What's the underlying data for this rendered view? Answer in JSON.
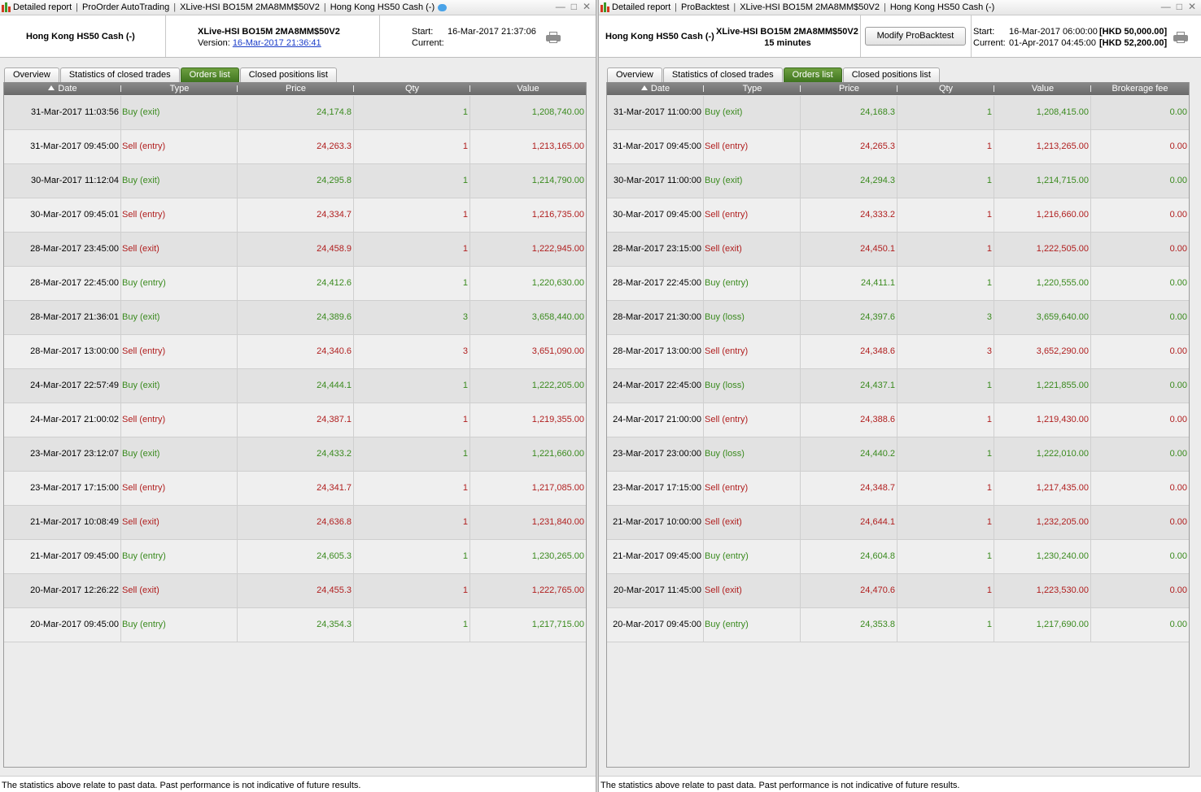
{
  "left": {
    "titlebar": {
      "segments": [
        "Detailed report",
        "ProOrder AutoTrading",
        "XLive-HSI BO15M 2MA8MM$50V2",
        "Hong Kong HS50 Cash (-)"
      ]
    },
    "header": {
      "instrument": "Hong Kong HS50 Cash (-)",
      "system_name": "XLive-HSI BO15M 2MA8MM$50V2",
      "version_label": "Version:",
      "version_value": "16-Mar-2017 21:36:41",
      "start_label": "Start:",
      "start_value": "16-Mar-2017 21:37:06",
      "current_label": "Current:"
    },
    "tabs": [
      "Overview",
      "Statistics of closed trades",
      "Orders list",
      "Closed positions list"
    ],
    "active_tab": 2,
    "columns": [
      "Date",
      "Type",
      "Price",
      "Qty",
      "Value"
    ],
    "rows": [
      {
        "date": "31-Mar-2017 11:03:56",
        "type": "Buy (exit)",
        "side": "buy",
        "price": "24,174.8",
        "qty": "1",
        "value": "1,208,740.00"
      },
      {
        "date": "31-Mar-2017 09:45:00",
        "type": "Sell (entry)",
        "side": "sell",
        "price": "24,263.3",
        "qty": "1",
        "value": "1,213,165.00"
      },
      {
        "date": "30-Mar-2017 11:12:04",
        "type": "Buy (exit)",
        "side": "buy",
        "price": "24,295.8",
        "qty": "1",
        "value": "1,214,790.00"
      },
      {
        "date": "30-Mar-2017 09:45:01",
        "type": "Sell (entry)",
        "side": "sell",
        "price": "24,334.7",
        "qty": "1",
        "value": "1,216,735.00"
      },
      {
        "date": "28-Mar-2017 23:45:00",
        "type": "Sell (exit)",
        "side": "sell",
        "price": "24,458.9",
        "qty": "1",
        "value": "1,222,945.00"
      },
      {
        "date": "28-Mar-2017 22:45:00",
        "type": "Buy (entry)",
        "side": "buy",
        "price": "24,412.6",
        "qty": "1",
        "value": "1,220,630.00"
      },
      {
        "date": "28-Mar-2017 21:36:01",
        "type": "Buy (exit)",
        "side": "buy",
        "price": "24,389.6",
        "qty": "3",
        "value": "3,658,440.00"
      },
      {
        "date": "28-Mar-2017 13:00:00",
        "type": "Sell (entry)",
        "side": "sell",
        "price": "24,340.6",
        "qty": "3",
        "value": "3,651,090.00"
      },
      {
        "date": "24-Mar-2017 22:57:49",
        "type": "Buy (exit)",
        "side": "buy",
        "price": "24,444.1",
        "qty": "1",
        "value": "1,222,205.00"
      },
      {
        "date": "24-Mar-2017 21:00:02",
        "type": "Sell (entry)",
        "side": "sell",
        "price": "24,387.1",
        "qty": "1",
        "value": "1,219,355.00"
      },
      {
        "date": "23-Mar-2017 23:12:07",
        "type": "Buy (exit)",
        "side": "buy",
        "price": "24,433.2",
        "qty": "1",
        "value": "1,221,660.00"
      },
      {
        "date": "23-Mar-2017 17:15:00",
        "type": "Sell (entry)",
        "side": "sell",
        "price": "24,341.7",
        "qty": "1",
        "value": "1,217,085.00"
      },
      {
        "date": "21-Mar-2017 10:08:49",
        "type": "Sell (exit)",
        "side": "sell",
        "price": "24,636.8",
        "qty": "1",
        "value": "1,231,840.00"
      },
      {
        "date": "21-Mar-2017 09:45:00",
        "type": "Buy (entry)",
        "side": "buy",
        "price": "24,605.3",
        "qty": "1",
        "value": "1,230,265.00"
      },
      {
        "date": "20-Mar-2017 12:26:22",
        "type": "Sell (exit)",
        "side": "sell",
        "price": "24,455.3",
        "qty": "1",
        "value": "1,222,765.00"
      },
      {
        "date": "20-Mar-2017 09:45:00",
        "type": "Buy (entry)",
        "side": "buy",
        "price": "24,354.3",
        "qty": "1",
        "value": "1,217,715.00"
      }
    ],
    "footer": "The statistics above relate to past data. Past performance is not indicative of future results."
  },
  "right": {
    "titlebar": {
      "segments": [
        "Detailed report",
        "ProBacktest",
        "XLive-HSI BO15M 2MA8MM$50V2",
        "Hong Kong HS50 Cash (-)"
      ]
    },
    "header": {
      "instrument": "Hong Kong HS50 Cash (-)",
      "system_name": "XLive-HSI BO15M 2MA8MM$50V2",
      "timeframe": "15 minutes",
      "modify_button": "Modify ProBacktest",
      "start_label": "Start:",
      "start_value": "16-Mar-2017 06:00:00",
      "start_capital": "[HKD 50,000.00]",
      "current_label": "Current:",
      "current_value": "01-Apr-2017 04:45:00",
      "current_capital": "[HKD 52,200.00]"
    },
    "tabs": [
      "Overview",
      "Statistics of closed trades",
      "Orders list",
      "Closed positions list"
    ],
    "active_tab": 2,
    "columns": [
      "Date",
      "Type",
      "Price",
      "Qty",
      "Value",
      "Brokerage fee"
    ],
    "rows": [
      {
        "date": "31-Mar-2017 11:00:00",
        "type": "Buy (exit)",
        "side": "buy",
        "price": "24,168.3",
        "qty": "1",
        "value": "1,208,415.00",
        "fee": "0.00"
      },
      {
        "date": "31-Mar-2017 09:45:00",
        "type": "Sell (entry)",
        "side": "sell",
        "price": "24,265.3",
        "qty": "1",
        "value": "1,213,265.00",
        "fee": "0.00"
      },
      {
        "date": "30-Mar-2017 11:00:00",
        "type": "Buy (exit)",
        "side": "buy",
        "price": "24,294.3",
        "qty": "1",
        "value": "1,214,715.00",
        "fee": "0.00"
      },
      {
        "date": "30-Mar-2017 09:45:00",
        "type": "Sell (entry)",
        "side": "sell",
        "price": "24,333.2",
        "qty": "1",
        "value": "1,216,660.00",
        "fee": "0.00"
      },
      {
        "date": "28-Mar-2017 23:15:00",
        "type": "Sell (exit)",
        "side": "sell",
        "price": "24,450.1",
        "qty": "1",
        "value": "1,222,505.00",
        "fee": "0.00"
      },
      {
        "date": "28-Mar-2017 22:45:00",
        "type": "Buy (entry)",
        "side": "buy",
        "price": "24,411.1",
        "qty": "1",
        "value": "1,220,555.00",
        "fee": "0.00"
      },
      {
        "date": "28-Mar-2017 21:30:00",
        "type": "Buy (loss)",
        "side": "buy",
        "price": "24,397.6",
        "qty": "3",
        "value": "3,659,640.00",
        "fee": "0.00"
      },
      {
        "date": "28-Mar-2017 13:00:00",
        "type": "Sell (entry)",
        "side": "sell",
        "price": "24,348.6",
        "qty": "3",
        "value": "3,652,290.00",
        "fee": "0.00"
      },
      {
        "date": "24-Mar-2017 22:45:00",
        "type": "Buy (loss)",
        "side": "buy",
        "price": "24,437.1",
        "qty": "1",
        "value": "1,221,855.00",
        "fee": "0.00"
      },
      {
        "date": "24-Mar-2017 21:00:00",
        "type": "Sell (entry)",
        "side": "sell",
        "price": "24,388.6",
        "qty": "1",
        "value": "1,219,430.00",
        "fee": "0.00"
      },
      {
        "date": "23-Mar-2017 23:00:00",
        "type": "Buy (loss)",
        "side": "buy",
        "price": "24,440.2",
        "qty": "1",
        "value": "1,222,010.00",
        "fee": "0.00"
      },
      {
        "date": "23-Mar-2017 17:15:00",
        "type": "Sell (entry)",
        "side": "sell",
        "price": "24,348.7",
        "qty": "1",
        "value": "1,217,435.00",
        "fee": "0.00"
      },
      {
        "date": "21-Mar-2017 10:00:00",
        "type": "Sell (exit)",
        "side": "sell",
        "price": "24,644.1",
        "qty": "1",
        "value": "1,232,205.00",
        "fee": "0.00"
      },
      {
        "date": "21-Mar-2017 09:45:00",
        "type": "Buy (entry)",
        "side": "buy",
        "price": "24,604.8",
        "qty": "1",
        "value": "1,230,240.00",
        "fee": "0.00"
      },
      {
        "date": "20-Mar-2017 11:45:00",
        "type": "Sell (exit)",
        "side": "sell",
        "price": "24,470.6",
        "qty": "1",
        "value": "1,223,530.00",
        "fee": "0.00"
      },
      {
        "date": "20-Mar-2017 09:45:00",
        "type": "Buy (entry)",
        "side": "buy",
        "price": "24,353.8",
        "qty": "1",
        "value": "1,217,690.00",
        "fee": "0.00"
      }
    ],
    "footer": "The statistics above relate to past data. Past performance is not indicative of future results."
  },
  "colors": {
    "buy": "#3a8a1e",
    "sell": "#b01e1e",
    "active_tab": "#4f8a2c",
    "header_bar": "#7a7a7a"
  },
  "icons": [
    "app-chart-icon",
    "chat-bubble-icon",
    "minimize-icon",
    "maximize-icon",
    "close-icon",
    "printer-icon",
    "sort-up-icon"
  ]
}
